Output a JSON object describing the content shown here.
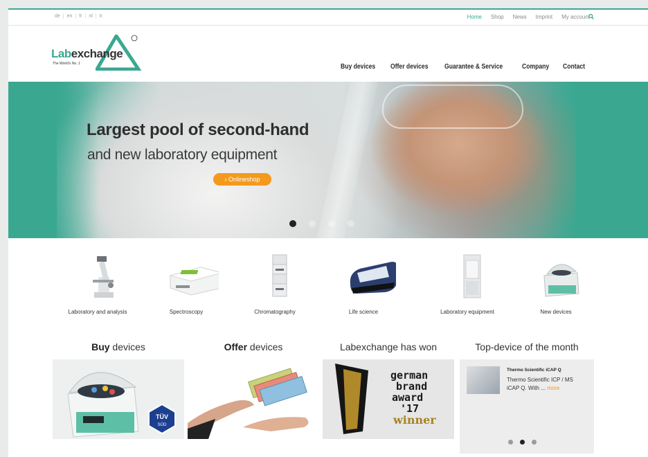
{
  "topbar": {
    "languages": [
      "de",
      "en",
      "fr",
      "nl",
      "it"
    ],
    "links": [
      "Home",
      "Shop",
      "News",
      "Imprint",
      "My account"
    ],
    "active_link": "Home"
  },
  "logo": {
    "lab": "Lab",
    "exchange": "exchange",
    "tagline": "The World's No. 1",
    "registered": "®"
  },
  "mainnav": [
    "Buy devices",
    "Offer devices",
    "Guarantee & Service",
    "Company",
    "Contact"
  ],
  "hero": {
    "title": "Largest pool of second-hand",
    "subtitle": "and new laboratory equipment",
    "button": "› Onlineshop",
    "slides": 4,
    "active_slide": 1
  },
  "categories": [
    {
      "label": "Laboratory and analysis",
      "icon": "microscope-icon"
    },
    {
      "label": "Spectroscopy",
      "icon": "spectrometer-icon"
    },
    {
      "label": "Chromatography",
      "icon": "chromatograph-icon"
    },
    {
      "label": "Life science",
      "icon": "thermocycler-icon"
    },
    {
      "label": "Laboratory equipment",
      "icon": "fume-hood-icon"
    },
    {
      "label": "New devices",
      "icon": "centrifuge-icon"
    }
  ],
  "sections": {
    "buy": {
      "bold": "Buy",
      "rest": " devices"
    },
    "offer": {
      "bold": "Offer",
      "rest": " devices"
    },
    "award": {
      "title": "Labexchange has won",
      "lines": [
        "german",
        "brand",
        "award",
        "'17",
        "winner"
      ]
    },
    "topdevice": {
      "title": "Top-device of the month",
      "heading": "Thermo Scientific iCAP Q",
      "text": "Thermo Scientific ICP / MS iCAP Q. With ... ",
      "more": "more",
      "active_dot": 2
    }
  },
  "badge": {
    "line1": "TÜV",
    "line2": "SÜD"
  },
  "colors": {
    "brand": "#3aa891",
    "accent": "#f39a1e"
  }
}
